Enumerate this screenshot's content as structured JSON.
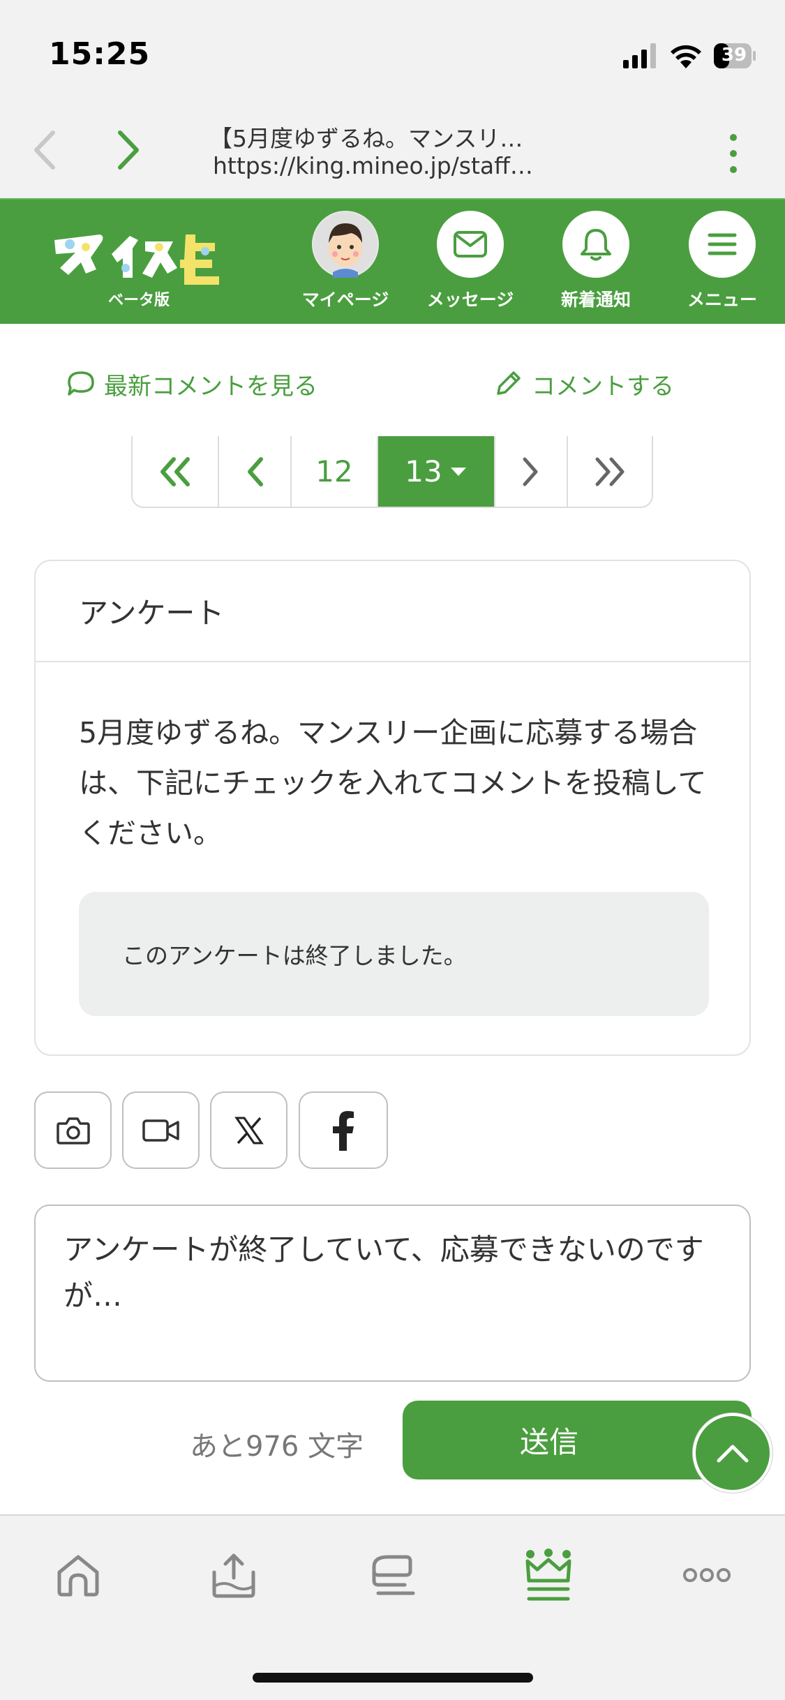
{
  "status": {
    "time": "15:25",
    "battery": "39"
  },
  "browser": {
    "title": "【5月度ゆずるね。マンスリ…",
    "url": "https://king.mineo.jp/staff…"
  },
  "header": {
    "logo_sub": "ベータ版",
    "mypage": "マイページ",
    "messages": "メッセージ",
    "notifications": "新着通知",
    "menu": "メニュー"
  },
  "actions": {
    "latest": "最新コメントを見る",
    "write": "コメントする"
  },
  "pagination": {
    "prev_page": "12",
    "current_page": "13"
  },
  "survey": {
    "heading": "アンケート",
    "body": "5月度ゆずるね。マンスリー企画に応募する場合は、下記にチェックを入れてコメントを投稿してください。",
    "closed_notice": "このアンケートは終了しました。"
  },
  "comment": {
    "text": "アンケートが終了していて、応募できないのですが…",
    "remaining": "あと976 文字",
    "send": "送信"
  },
  "colors": {
    "brand_green": "#4a9e3f",
    "toolbar_bg": "#f2f2f2"
  }
}
